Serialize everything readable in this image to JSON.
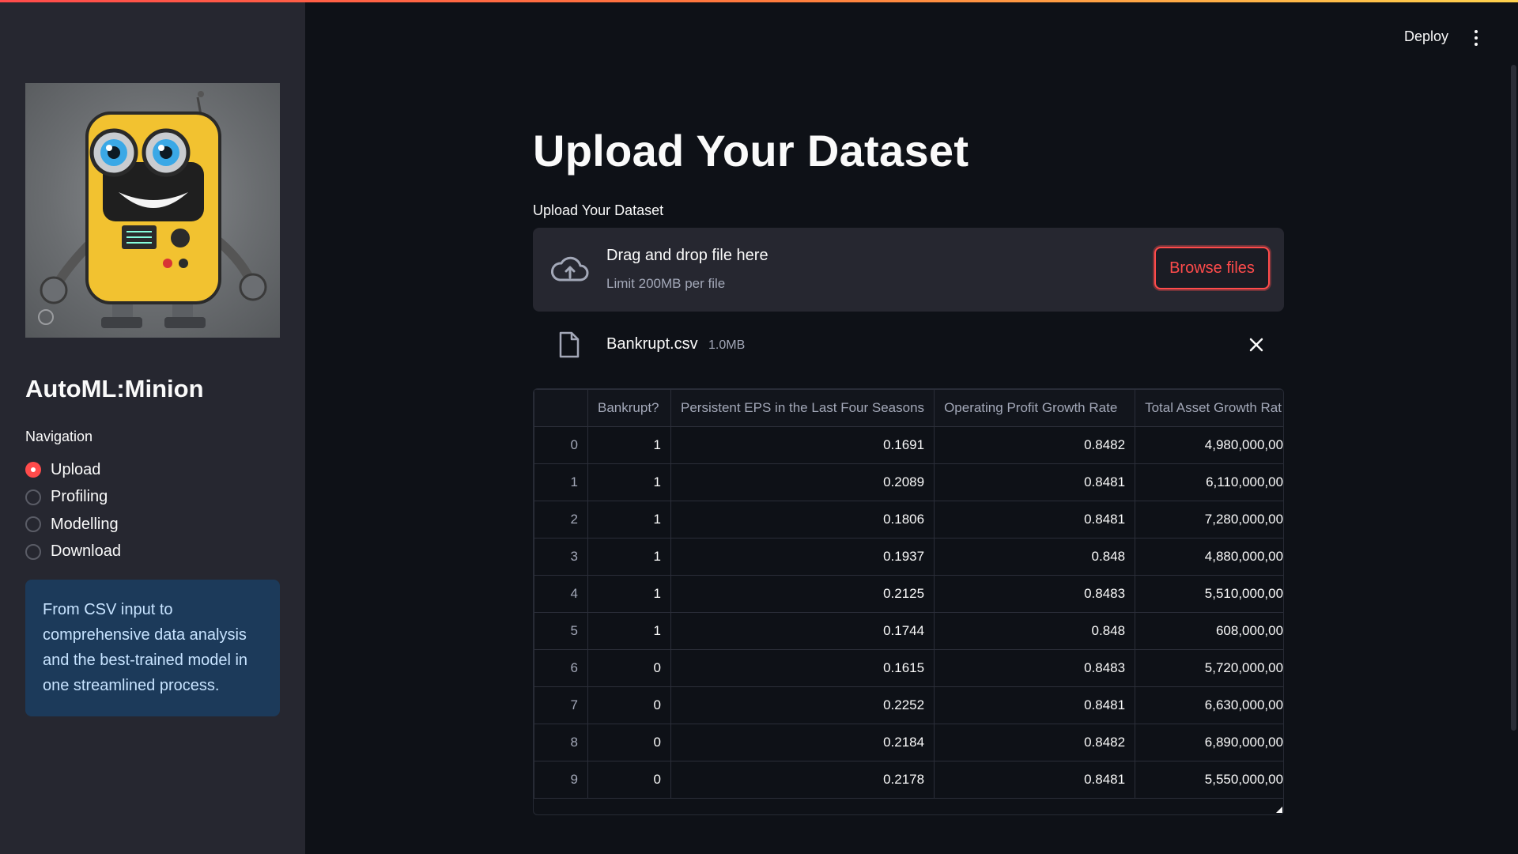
{
  "header": {
    "deploy_label": "Deploy",
    "menu_icon": "kebab-menu-icon"
  },
  "sidebar": {
    "logo_icon": "robot-mascot-image",
    "app_title": "AutoML:Minion",
    "nav_label": "Navigation",
    "nav_items": [
      {
        "label": "Upload",
        "checked": true
      },
      {
        "label": "Profiling",
        "checked": false
      },
      {
        "label": "Modelling",
        "checked": false
      },
      {
        "label": "Download",
        "checked": false
      }
    ],
    "info_text": "From CSV input to comprehensive data analysis and the best-trained model in one streamlined process."
  },
  "main": {
    "title": "Upload Your Dataset",
    "uploader": {
      "label": "Upload Your Dataset",
      "drop_title": "Drag and drop file here",
      "drop_limit": "Limit 200MB per file",
      "browse_label": "Browse files",
      "icon": "cloud-upload-icon"
    },
    "file": {
      "name": "Bankrupt.csv",
      "size": "1.0MB",
      "icon": "file-icon",
      "remove_icon": "close-icon"
    },
    "table": {
      "columns": [
        "",
        "Bankrupt?",
        "Persistent EPS in the Last Four Seasons",
        "Operating Profit Growth Rate",
        "Total Asset Growth Rat"
      ],
      "rows": [
        [
          "0",
          "1",
          "0.1691",
          "0.8482",
          "4,980,000,00"
        ],
        [
          "1",
          "1",
          "0.2089",
          "0.8481",
          "6,110,000,00"
        ],
        [
          "2",
          "1",
          "0.1806",
          "0.8481",
          "7,280,000,00"
        ],
        [
          "3",
          "1",
          "0.1937",
          "0.848",
          "4,880,000,00"
        ],
        [
          "4",
          "1",
          "0.2125",
          "0.8483",
          "5,510,000,00"
        ],
        [
          "5",
          "1",
          "0.1744",
          "0.848",
          "608,000,00"
        ],
        [
          "6",
          "0",
          "0.1615",
          "0.8483",
          "5,720,000,00"
        ],
        [
          "7",
          "0",
          "0.2252",
          "0.8481",
          "6,630,000,00"
        ],
        [
          "8",
          "0",
          "0.2184",
          "0.8482",
          "6,890,000,00"
        ],
        [
          "9",
          "0",
          "0.2178",
          "0.8481",
          "5,550,000,00"
        ]
      ]
    }
  },
  "colors": {
    "accent": "#ff4b4b",
    "background": "#0e1117",
    "sidebar": "#262730",
    "info_bg": "#1c3a5a"
  }
}
